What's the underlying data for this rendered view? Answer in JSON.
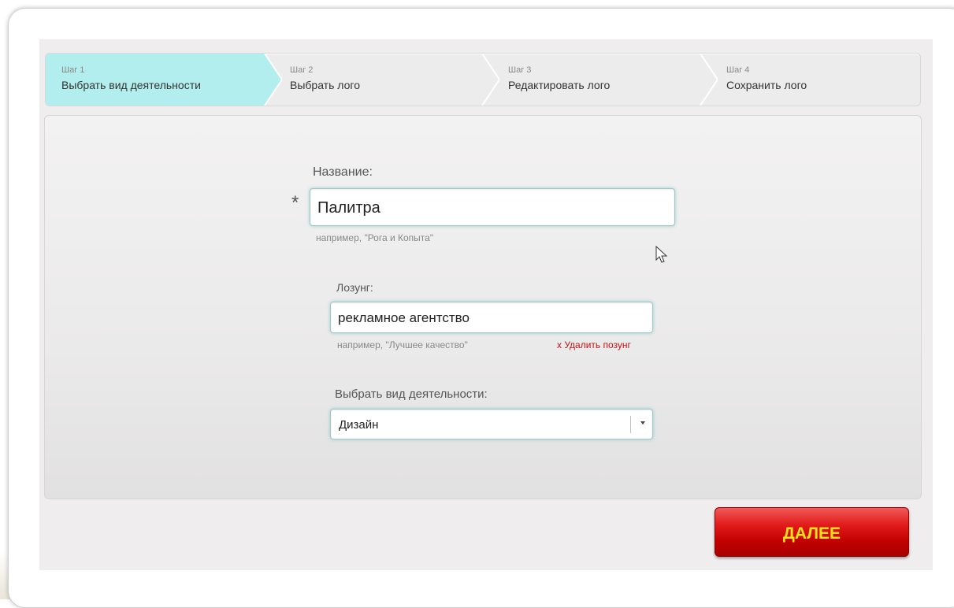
{
  "steps": [
    {
      "number": "Шаг 1",
      "label": "Выбрать вид деятельности",
      "active": true
    },
    {
      "number": "Шаг 2",
      "label": "Выбрать лого",
      "active": false
    },
    {
      "number": "Шаг 3",
      "label": "Редактировать лого",
      "active": false
    },
    {
      "number": "Шаг 4",
      "label": "Сохранить лого",
      "active": false
    }
  ],
  "form": {
    "name": {
      "label": "Название:",
      "required_mark": "*",
      "value": "Палитра",
      "hint": "например, \"Рога и Копыта\""
    },
    "slogan": {
      "label": "Лозунг:",
      "value": "рекламное агентство",
      "hint": "например, \"Лучшее качество\"",
      "delete_label": "x Удалить позунг"
    },
    "activity": {
      "label": "Выбрать вид деятельности:",
      "selected": "Дизайн"
    }
  },
  "actions": {
    "next_label": "ДАЛЕЕ"
  },
  "colors": {
    "active_step": "#b3eeee",
    "next_button": "#d10000",
    "next_text": "#ffe21a",
    "delete_link": "#c0131a"
  }
}
